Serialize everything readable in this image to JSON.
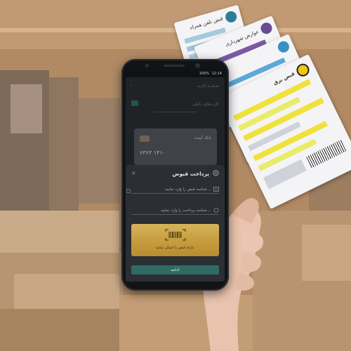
{
  "status_bar": {
    "battery": "100%",
    "time": "12:14"
  },
  "screen": {
    "card_number_label": "شماره کارت",
    "bank_cards_label": "کارت‌های بانکی",
    "bank_card": {
      "bank_name": "بانک آینده",
      "number": "۶۳۶۳   ۱۴۱۰"
    }
  },
  "bill_sheet": {
    "title": "پرداخت قبوض",
    "bill_id_placeholder": "شناسه قبض را وارد نمایید...",
    "payment_id_placeholder": "شناسه پرداخت را وارد نمایید...",
    "barcode_hint": "بارکد قبض را اسکن نمایید.",
    "continue_label": "ادامه"
  },
  "bills": {
    "phone_title": "قبض تلفن همراه",
    "municipality_title": "عوارض شهرداری",
    "power_title": "قبض برق"
  },
  "colors": {
    "accent_gold": "#c49a3c",
    "button_teal": "#2f6b63",
    "sheet_bg": "#2b2f33"
  }
}
